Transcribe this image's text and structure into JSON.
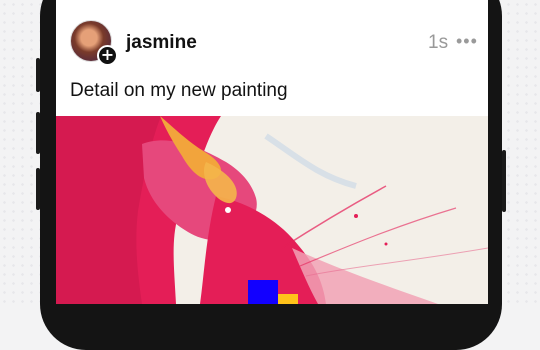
{
  "post": {
    "username": "jasmine",
    "timestamp": "1s",
    "add_symbol": "+",
    "more_symbol": "•••",
    "caption": "Detail on my new painting"
  },
  "image": {
    "icon": "abstract-painting",
    "colors": {
      "paper": "#f3efe8",
      "magenta": "#e41e57",
      "pink": "#f1a2b5",
      "orange": "#f2a43c",
      "blue": "#1200ff",
      "yellow": "#ffc21a"
    }
  },
  "colors": {
    "phone_frame": "#141414",
    "screen_bg": "#ffffff",
    "text_primary": "#121212",
    "text_secondary": "#999999"
  }
}
